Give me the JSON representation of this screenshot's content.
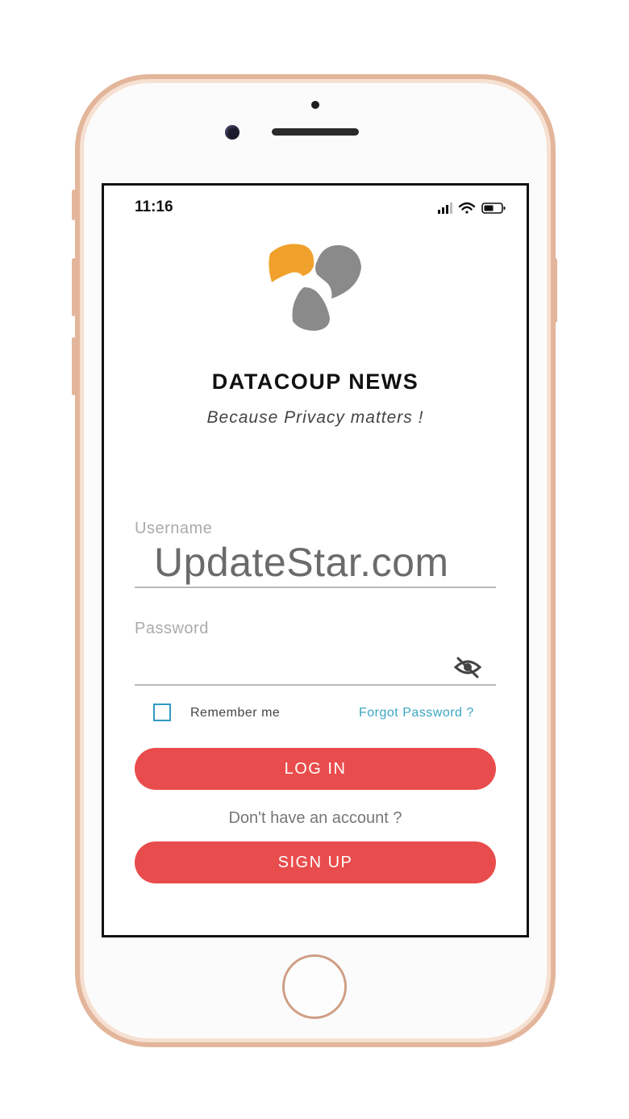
{
  "status_bar": {
    "time": "11:16"
  },
  "brand": {
    "title": "DATACOUP NEWS",
    "tagline": "Because Privacy matters !",
    "logo_colors": {
      "orange": "#f0a12b",
      "gray": "#8a8a8a"
    }
  },
  "login_form": {
    "username_label": "Username",
    "username_value": "",
    "password_label": "Password",
    "password_value": "",
    "password_toggle_icon": "eye-off-icon",
    "remember_label": "Remember me",
    "remember_checked": false,
    "forgot_link": "Forgot Password ?",
    "login_button": "LOG IN",
    "no_account_text": "Don't have an account ?",
    "signup_button": "SIGN UP"
  },
  "watermark": "UpdateStar.com",
  "colors": {
    "button": "#e94c4c",
    "link": "#3aa6c4",
    "checkbox": "#2f9bc2",
    "frame": "#e3b69b"
  }
}
